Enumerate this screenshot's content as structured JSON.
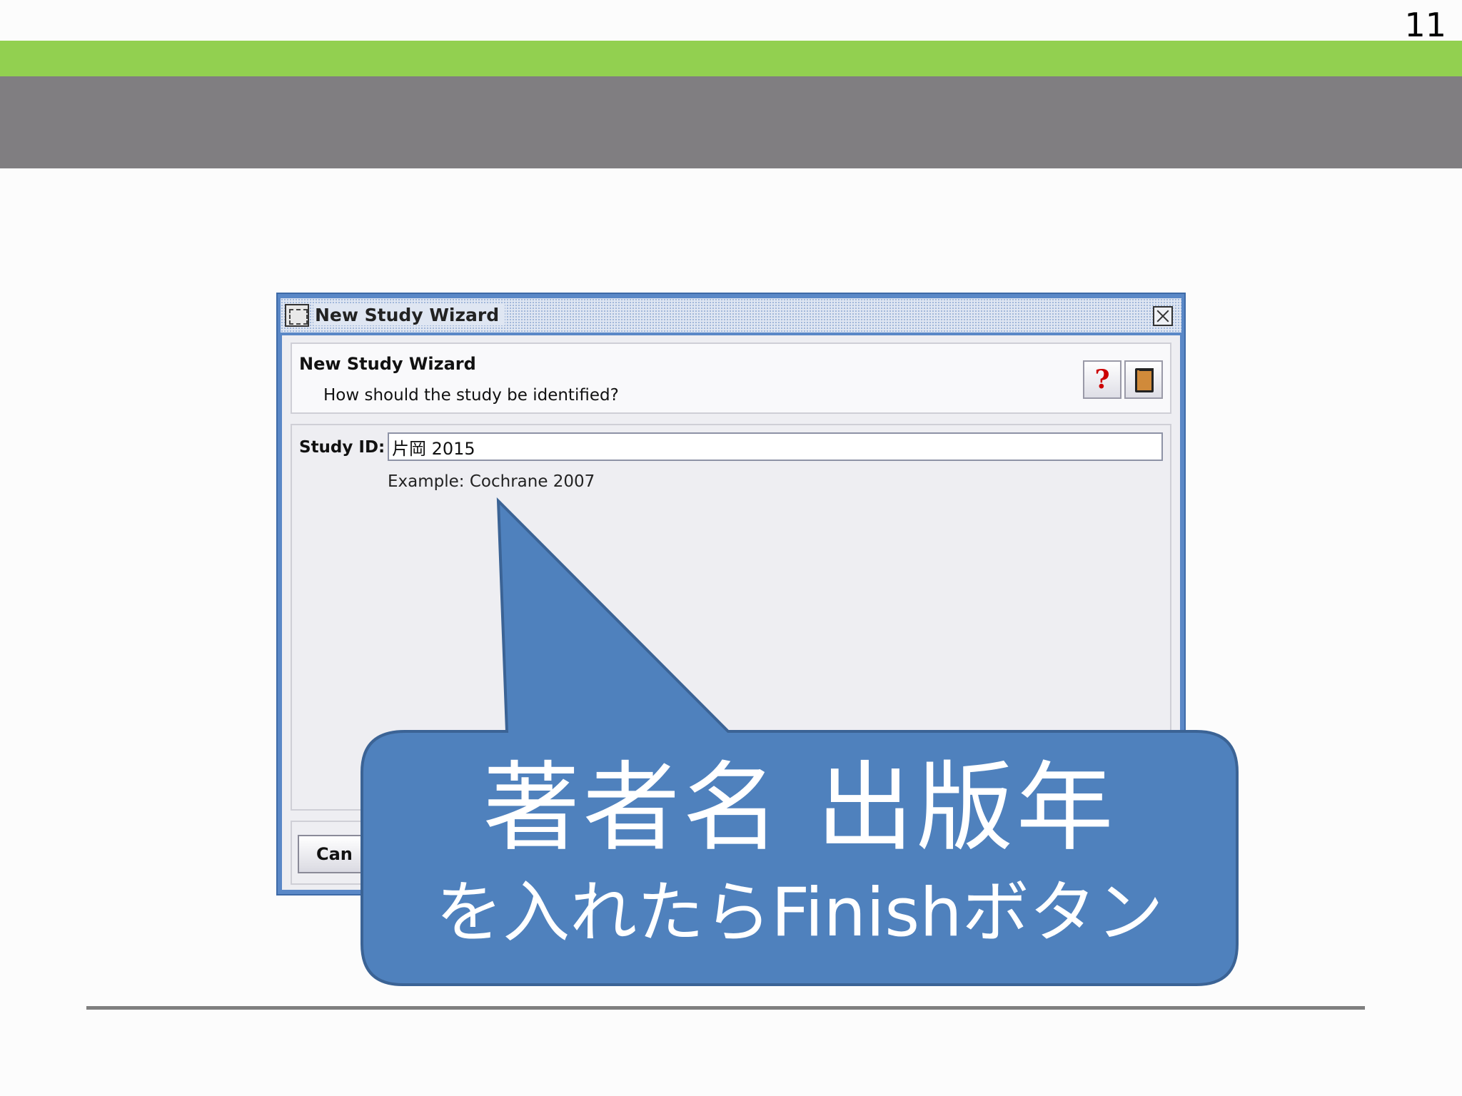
{
  "slide": {
    "number": "11",
    "colors": {
      "green_bar": "#92d050",
      "gray_bar": "#807e81",
      "callout": "#4f81bd"
    }
  },
  "dialog": {
    "window_title": "New Study Wizard",
    "header_title": "New Study Wizard",
    "header_subtitle": "How should the study be identified?",
    "help_button_glyph": "?",
    "icons": [
      "wizard-icon",
      "close-icon",
      "help-icon",
      "book-icon"
    ],
    "study_id_label": "Study ID:",
    "study_id_value": "片岡 2015",
    "study_id_example": "Example: Cochrane 2007",
    "cancel_label": "Can"
  },
  "callout": {
    "line1": "著者名 出版年",
    "line2": "を入れたらFinishボタン"
  }
}
